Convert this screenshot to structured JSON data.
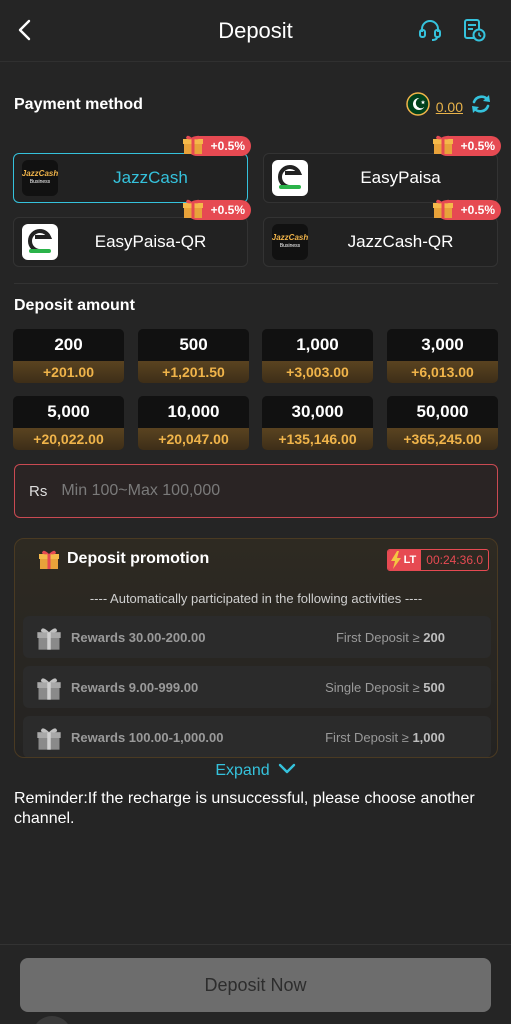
{
  "header": {
    "title": "Deposit"
  },
  "payment": {
    "title": "Payment method",
    "balance": "0.00",
    "methods": [
      {
        "label": "JazzCash",
        "bonus": "+0.5%",
        "logo_text": "JazzCash",
        "logo_sub": "Business"
      },
      {
        "label": "EasyPaisa",
        "bonus": "+0.5%"
      },
      {
        "label": "EasyPaisa-QR",
        "bonus": "+0.5%"
      },
      {
        "label": "JazzCash-QR",
        "bonus": "+0.5%",
        "logo_text": "JazzCash",
        "logo_sub": "Business"
      }
    ]
  },
  "deposit": {
    "title": "Deposit amount",
    "amounts": [
      {
        "value": "200",
        "bonus": "+201.00"
      },
      {
        "value": "500",
        "bonus": "+1,201.50"
      },
      {
        "value": "1,000",
        "bonus": "+3,003.00"
      },
      {
        "value": "3,000",
        "bonus": "+6,013.00"
      },
      {
        "value": "5,000",
        "bonus": "+20,022.00"
      },
      {
        "value": "10,000",
        "bonus": "+20,047.00"
      },
      {
        "value": "30,000",
        "bonus": "+135,146.00"
      },
      {
        "value": "50,000",
        "bonus": "+365,245.00"
      }
    ],
    "currency": "Rs",
    "placeholder": "Min 100~Max 100,000"
  },
  "promotion": {
    "title": "Deposit promotion",
    "lt_label": "LT",
    "timer": "00:24:36.0",
    "subtitle": "---- Automatically participated in the following activities ----",
    "rewards": [
      {
        "text": "Rewards 30.00-200.00",
        "cond": "First Deposit ≥",
        "cond_value": "200"
      },
      {
        "text": "Rewards 9.00-999.00",
        "cond": "Single Deposit ≥",
        "cond_value": "500"
      },
      {
        "text": "Rewards 100.00-1,000.00",
        "cond": "First Deposit ≥",
        "cond_value": "1,000"
      }
    ]
  },
  "expand_label": "Expand",
  "reminder": "Reminder:If the recharge is unsuccessful, please choose another channel.",
  "submit_label": "Deposit Now",
  "colors": {
    "accent": "#35c2dc",
    "gold": "#f0b44a",
    "danger": "#e64a52"
  }
}
